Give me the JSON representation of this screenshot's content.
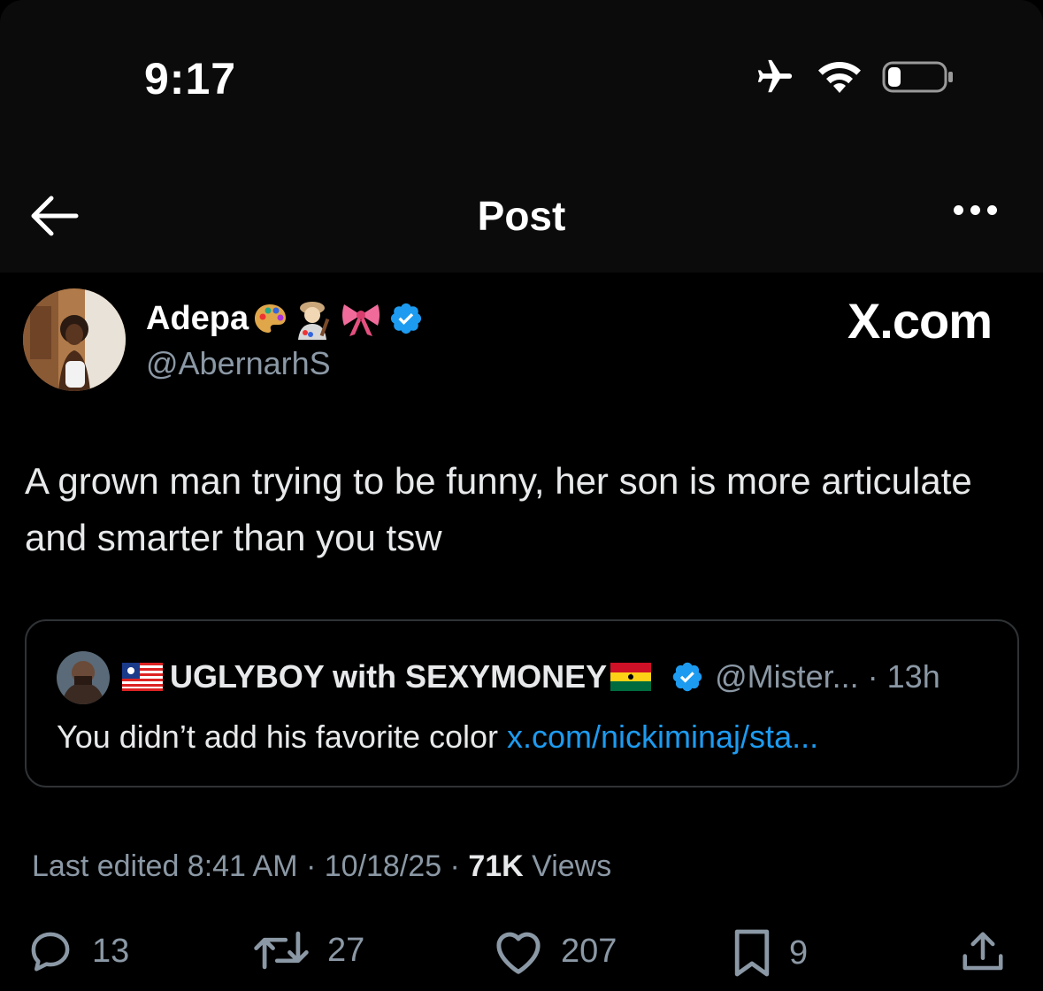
{
  "status_bar": {
    "time": "9:17"
  },
  "nav": {
    "title": "Post"
  },
  "post": {
    "author_name": "Adepa",
    "author_handle": "@AbernarhS",
    "watermark": "X.com",
    "text": "A grown man trying to be funny,  her  son is more articulate and smarter than you tsw",
    "meta": {
      "edited": "Last edited 8:41 AM · 10/18/25 · ",
      "views_count": "71K",
      "views_label": " Views"
    }
  },
  "quote": {
    "name": "UGLYBOY with SEXYMONEY",
    "handle": "@Mister... · 13h",
    "text": "You didn’t add his favorite color ",
    "link": "x.com/nickiminaj/sta..."
  },
  "actions": {
    "replies": "13",
    "reposts": "27",
    "likes": "207",
    "bookmarks": "9"
  },
  "icons": [
    "airplane-icon",
    "wifi-icon",
    "battery-icon",
    "back-arrow-icon",
    "more-icon",
    "verified-icon",
    "reply-icon",
    "repost-icon",
    "like-icon",
    "bookmark-icon",
    "share-icon"
  ],
  "colors": {
    "background": "#000000",
    "link": "#1d9bf0",
    "verified": "#1d9bf0",
    "muted": "#8b98a5"
  }
}
